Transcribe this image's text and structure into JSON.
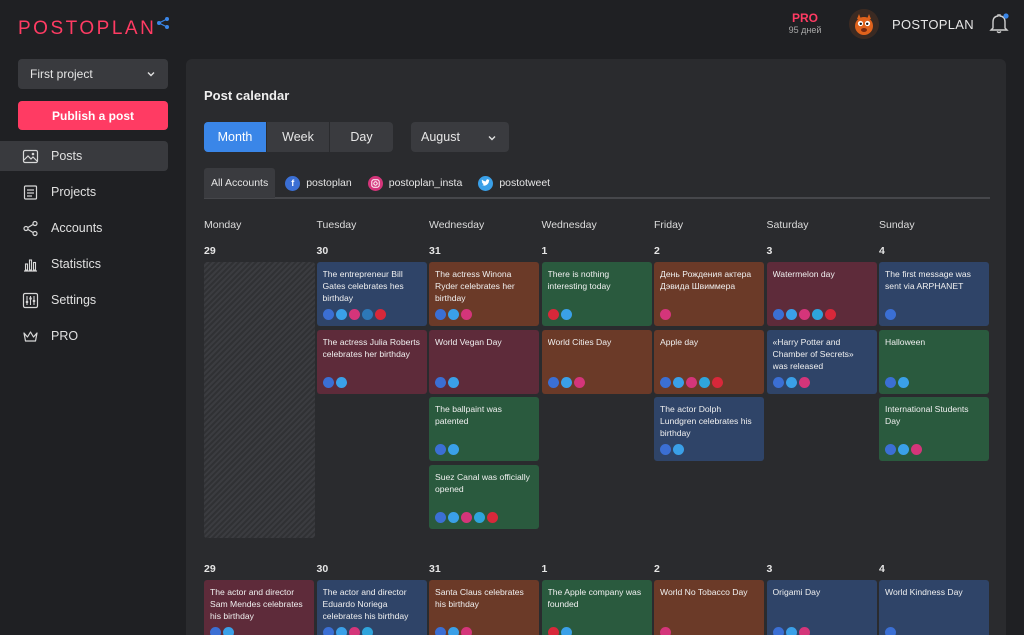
{
  "header": {
    "logo": "POSTOPLAN",
    "pro_label": "PRO",
    "pro_days": "95 дней",
    "username": "POSTOPLAN"
  },
  "sidebar": {
    "project": "First project",
    "publish_label": "Publish a post",
    "items": [
      {
        "label": "Posts",
        "icon": "image-icon",
        "active": true
      },
      {
        "label": "Projects",
        "icon": "projects-icon"
      },
      {
        "label": "Accounts",
        "icon": "share-icon"
      },
      {
        "label": "Statistics",
        "icon": "chart-icon"
      },
      {
        "label": "Settings",
        "icon": "sliders-icon"
      },
      {
        "label": "PRO",
        "icon": "crown-icon"
      }
    ]
  },
  "calendar": {
    "title": "Post calendar",
    "views": [
      "Month",
      "Week",
      "Day"
    ],
    "active_view": "Month",
    "month": "August",
    "accounts": [
      {
        "label": "All Accounts",
        "active": true
      },
      {
        "label": "postoplan",
        "network": "facebook"
      },
      {
        "label": "postoplan_insta",
        "network": "instagram"
      },
      {
        "label": "postotweet",
        "network": "twitter"
      }
    ],
    "day_names": [
      "Monday",
      "Tuesday",
      "Wednesday",
      "Wednesday",
      "Friday",
      "Saturday",
      "Sunday"
    ],
    "weeks": [
      {
        "days": [
          "29",
          "30",
          "31",
          "1",
          "2",
          "3",
          "4"
        ],
        "cards": [
          {
            "col": 1,
            "row": 0,
            "color": "blue",
            "text": "The entrepreneur Bill Gates celebrates hes birthday",
            "icons": [
              "fb",
              "tw",
              "ig",
              "li",
              "pi"
            ]
          },
          {
            "col": 1,
            "row": 1,
            "color": "red",
            "text": "The actress Julia Roberts celebrates her birthday",
            "icons": [
              "fb",
              "tw"
            ]
          },
          {
            "col": 2,
            "row": 0,
            "color": "brown",
            "text": "The actress Winona Ryder celebrates her birthday",
            "icons": [
              "fb",
              "tw",
              "ig"
            ]
          },
          {
            "col": 2,
            "row": 1,
            "color": "red",
            "text": "World Vegan Day",
            "icons": [
              "fb",
              "tw"
            ]
          },
          {
            "col": 2,
            "row": 2,
            "color": "green",
            "text": "The ballpaint was patented",
            "icons": [
              "fb",
              "tw"
            ]
          },
          {
            "col": 2,
            "row": 3,
            "color": "green",
            "text": "Suez Canal was officially opened",
            "icons": [
              "fb",
              "tw",
              "ig",
              "tg",
              "pi"
            ]
          },
          {
            "col": 3,
            "row": 0,
            "color": "green",
            "text": "There is nothing interesting today",
            "icons": [
              "pi",
              "tw"
            ]
          },
          {
            "col": 3,
            "row": 1,
            "color": "brown",
            "text": "World Cities Day",
            "icons": [
              "fb",
              "tw",
              "ig"
            ]
          },
          {
            "col": 4,
            "row": 0,
            "color": "brown",
            "text": "День Рождения актера Дэвида Швиммера",
            "icons": [
              "ig"
            ]
          },
          {
            "col": 4,
            "row": 1,
            "color": "brown",
            "text": "Apple day",
            "icons": [
              "fb",
              "tw",
              "ig",
              "tg",
              "pi"
            ]
          },
          {
            "col": 4,
            "row": 2,
            "color": "blue",
            "text": "The actor Dolph Lundgren celebrates his birthday",
            "icons": [
              "fb",
              "tw"
            ]
          },
          {
            "col": 5,
            "row": 0,
            "color": "red",
            "text": "Watermelon day",
            "icons": [
              "fb",
              "tw",
              "ig",
              "tg",
              "pi"
            ]
          },
          {
            "col": 5,
            "row": 1,
            "color": "blue",
            "text": "«Harry Potter and Chamber of Secrets» was released",
            "icons": [
              "fb",
              "tw",
              "ig"
            ]
          },
          {
            "col": 6,
            "row": 0,
            "color": "blue",
            "text": "The first message was sent via ARPHANET",
            "icons": [
              "fb"
            ]
          },
          {
            "col": 6,
            "row": 1,
            "color": "green",
            "text": "Halloween",
            "icons": [
              "fb",
              "tw"
            ]
          },
          {
            "col": 6,
            "row": 2,
            "color": "green",
            "text": "International Students Day",
            "icons": [
              "fb",
              "tw",
              "ig"
            ]
          }
        ]
      },
      {
        "days": [
          "29",
          "30",
          "31",
          "1",
          "2",
          "3",
          "4"
        ],
        "cards": [
          {
            "col": 0,
            "row": 0,
            "color": "red",
            "text": "The actor and director Sam Mendes celebrates his birthday",
            "icons": [
              "fb",
              "tw"
            ]
          },
          {
            "col": 1,
            "row": 0,
            "color": "blue",
            "text": "The actor and director Eduardo Noriega celebrates his birthday",
            "icons": [
              "fb",
              "tw",
              "ig",
              "tg"
            ]
          },
          {
            "col": 2,
            "row": 0,
            "color": "brown",
            "text": "Santa Claus celebrates his birthday",
            "icons": [
              "fb",
              "tw",
              "ig"
            ]
          },
          {
            "col": 3,
            "row": 0,
            "color": "green",
            "text": "The Apple company was founded",
            "icons": [
              "pi",
              "tw"
            ]
          },
          {
            "col": 4,
            "row": 0,
            "color": "brown",
            "text": "World No Tobacco Day",
            "icons": [
              "ig"
            ]
          },
          {
            "col": 5,
            "row": 0,
            "color": "blue",
            "text": "Origami Day",
            "icons": [
              "fb",
              "tw",
              "ig"
            ]
          },
          {
            "col": 6,
            "row": 0,
            "color": "blue",
            "text": "World Kindness Day",
            "icons": [
              "fb"
            ]
          }
        ]
      }
    ]
  }
}
